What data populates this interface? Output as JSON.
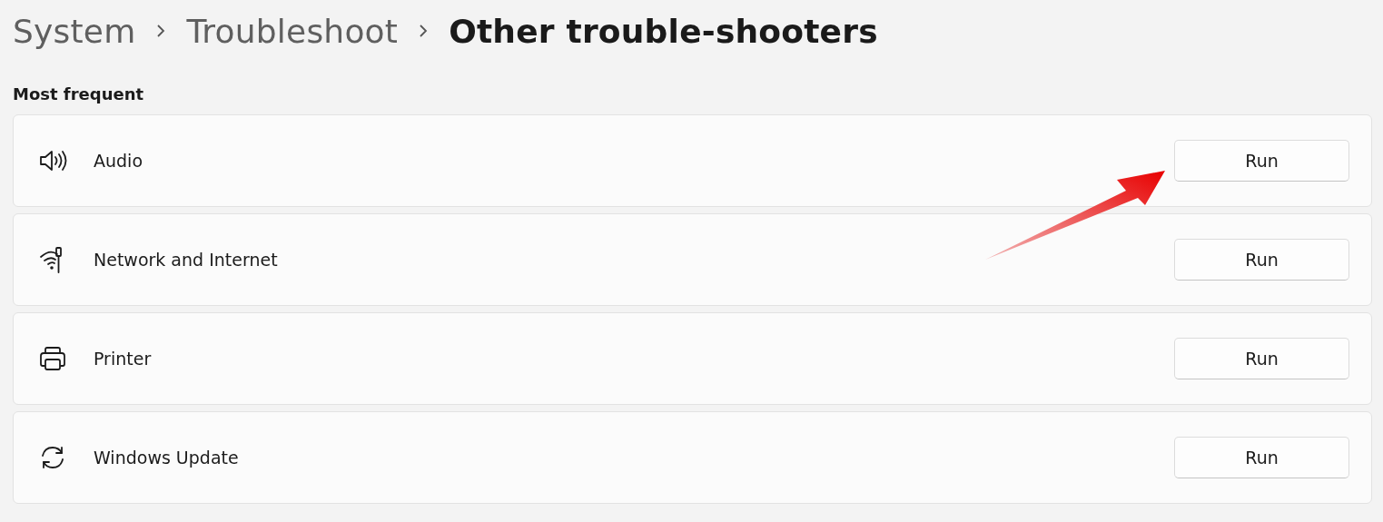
{
  "breadcrumb": [
    {
      "label": "System",
      "selected": false
    },
    {
      "label": "Troubleshoot",
      "selected": false
    },
    {
      "label": "Other trouble-shooters",
      "selected": true
    }
  ],
  "section": {
    "title": "Most frequent"
  },
  "troubleshooters": [
    {
      "kind": "audio",
      "label": "Audio",
      "button": "Run"
    },
    {
      "kind": "network",
      "label": "Network and Internet",
      "button": "Run"
    },
    {
      "kind": "printer",
      "label": "Printer",
      "button": "Run"
    },
    {
      "kind": "update",
      "label": "Windows Update",
      "button": "Run"
    }
  ]
}
